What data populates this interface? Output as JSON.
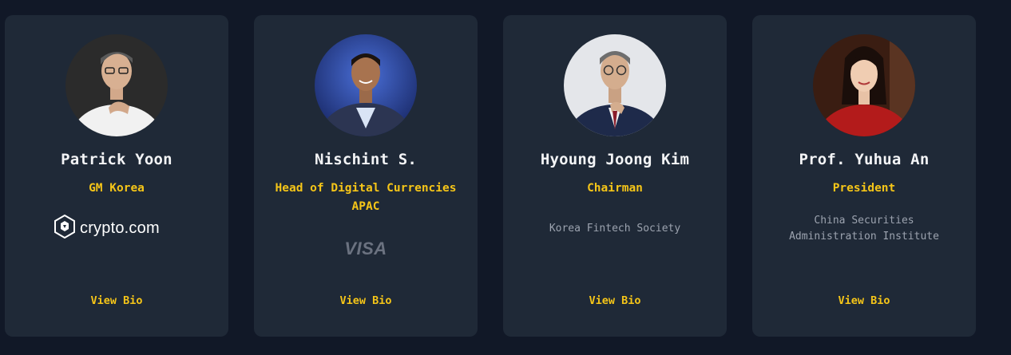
{
  "speakers": [
    {
      "name": "Patrick Yoon",
      "role": "GM Korea",
      "org_logo": "crypto.com",
      "org_logo_icon": "crypto-com-lion-shield-icon",
      "view_bio": "View Bio"
    },
    {
      "name": "Nischint S.",
      "role": "Head of Digital Currencies APAC",
      "org_logo": "VISA",
      "view_bio": "View Bio"
    },
    {
      "name": "Hyoung Joong Kim",
      "role": "Chairman",
      "organization": "Korea Fintech Society",
      "view_bio": "View Bio"
    },
    {
      "name": "Prof. Yuhua An",
      "role": "President",
      "organization": "China Securities Administration Institute",
      "view_bio": "View Bio"
    }
  ],
  "colors": {
    "page_background": "#111827",
    "card_background": "#1f2937",
    "accent": "#f5c518",
    "name_text": "#f3f4f6",
    "muted_text": "#9ca3af"
  }
}
